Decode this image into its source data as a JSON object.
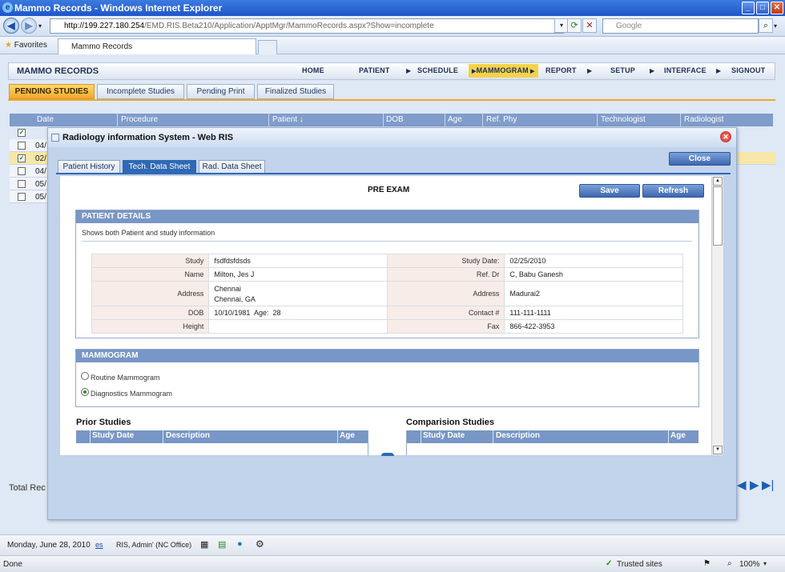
{
  "browser": {
    "title": "Mammo Records - Windows Internet Explorer",
    "address_host": "http://199.227.180.254",
    "address_path": "/EMD.RIS.Beta210/Application/ApptMgr/MammoRecords.aspx?Show=incomplete",
    "search_placeholder": "Google",
    "favorites_label": "Favorites",
    "tab_label": "Mammo Records",
    "status_left": "Done",
    "zone": "Trusted sites",
    "zoom": "100%"
  },
  "app": {
    "brand": "MAMMO RECORDS",
    "menu": [
      "HOME",
      "PATIENT",
      "SCHEDULE",
      "MAMMOGRAM",
      "REPORT",
      "SETUP",
      "INTERFACE",
      "SIGNOUT"
    ],
    "active_menu": "MAMMOGRAM",
    "page_tabs": [
      "PENDING STUDIES",
      "Incomplete Studies",
      "Pending Print",
      "Finalized Studies"
    ],
    "grid_columns": [
      "Date",
      "Procedure",
      "Patient ↓",
      "DOB",
      "Age",
      "Ref. Phy",
      "Technologist",
      "Radiologist"
    ],
    "grid_rows": [
      "04/",
      "02/",
      "04/",
      "05/",
      "05/"
    ],
    "total_label": "Total Rec"
  },
  "modal": {
    "title": "Radiology information System - Web RIS",
    "close_label": "Close",
    "tabs": [
      "Patient History",
      "Tech. Data Sheet",
      "Rad. Data Sheet"
    ],
    "heading": "PRE EXAM",
    "save_label": "Save",
    "refresh_label": "Refresh",
    "patient_details": {
      "header": "PATIENT DETAILS",
      "description": "Shows both Patient and study information",
      "study_label": "Study",
      "study": "fsdfdsfdsds",
      "name_label": "Name",
      "name": "Milton, Jes J",
      "address_label": "Address",
      "address_line1": "Chennai",
      "address_line2": "Chennai, GA",
      "dob_label": "DOB",
      "dob": "10/10/1981",
      "age_label": "Age:",
      "age": "28",
      "height_label": "Height",
      "height": "",
      "study_date_label": "Study Date:",
      "study_date": "02/25/2010",
      "ref_dr_label": "Ref. Dr",
      "ref_dr": "C, Babu Ganesh",
      "address2_label": "Address",
      "address2": "Madurai2",
      "contact_label": "Contact #",
      "contact": "111-111-1111",
      "fax_label": "Fax",
      "fax": "866-422-3953"
    },
    "mammogram": {
      "header": "MAMMOGRAM",
      "options": [
        "Routine Mammogram",
        "Diagnostics Mammogram"
      ],
      "selected": "Diagnostics Mammogram"
    },
    "prior_studies": {
      "title": "Prior Studies",
      "columns": [
        "Study Date",
        "Description",
        "Age"
      ]
    },
    "comparison_studies": {
      "title": "Comparision Studies",
      "columns": [
        "Study Date",
        "Description",
        "Age"
      ]
    }
  },
  "footer": {
    "date": "Monday, June 28, 2010",
    "lang": "es",
    "user": "RIS, Admin' (NC Office)"
  }
}
